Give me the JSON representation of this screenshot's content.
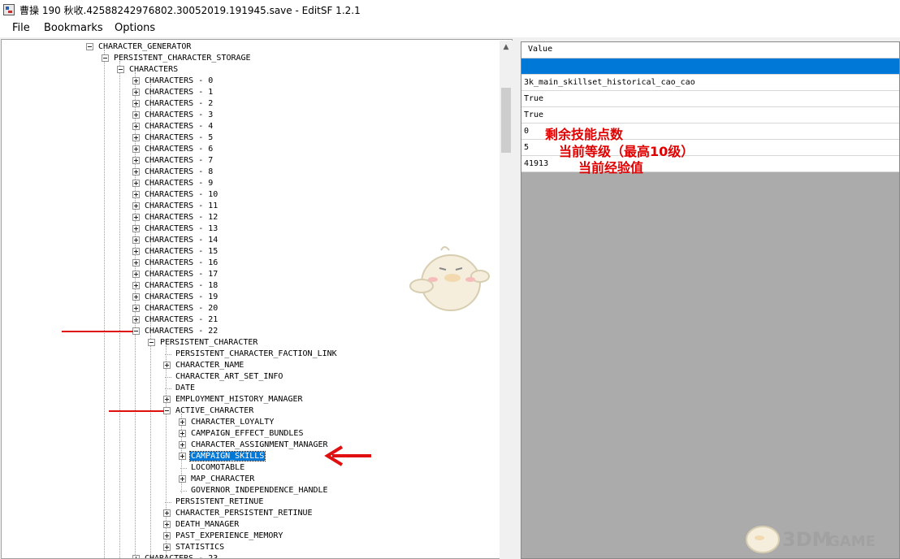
{
  "window": {
    "title": "曹操 190 秋收.42588242976802.30052019.191945.save - EditSF 1.2.1"
  },
  "menu": {
    "items": [
      "File",
      "Bookmarks",
      "Options"
    ]
  },
  "tree": {
    "rows": [
      {
        "label": "CHARACTER_GENERATOR",
        "level": 0,
        "expander": "minus"
      },
      {
        "label": "PERSISTENT_CHARACTER_STORAGE",
        "level": 1,
        "expander": "minus"
      },
      {
        "label": "CHARACTERS",
        "level": 2,
        "expander": "minus"
      },
      {
        "label": "CHARACTERS - 0",
        "level": 3,
        "expander": "plus"
      },
      {
        "label": "CHARACTERS - 1",
        "level": 3,
        "expander": "plus"
      },
      {
        "label": "CHARACTERS - 2",
        "level": 3,
        "expander": "plus"
      },
      {
        "label": "CHARACTERS - 3",
        "level": 3,
        "expander": "plus"
      },
      {
        "label": "CHARACTERS - 4",
        "level": 3,
        "expander": "plus"
      },
      {
        "label": "CHARACTERS - 5",
        "level": 3,
        "expander": "plus"
      },
      {
        "label": "CHARACTERS - 6",
        "level": 3,
        "expander": "plus"
      },
      {
        "label": "CHARACTERS - 7",
        "level": 3,
        "expander": "plus"
      },
      {
        "label": "CHARACTERS - 8",
        "level": 3,
        "expander": "plus"
      },
      {
        "label": "CHARACTERS - 9",
        "level": 3,
        "expander": "plus"
      },
      {
        "label": "CHARACTERS - 10",
        "level": 3,
        "expander": "plus"
      },
      {
        "label": "CHARACTERS - 11",
        "level": 3,
        "expander": "plus"
      },
      {
        "label": "CHARACTERS - 12",
        "level": 3,
        "expander": "plus"
      },
      {
        "label": "CHARACTERS - 13",
        "level": 3,
        "expander": "plus"
      },
      {
        "label": "CHARACTERS - 14",
        "level": 3,
        "expander": "plus"
      },
      {
        "label": "CHARACTERS - 15",
        "level": 3,
        "expander": "plus"
      },
      {
        "label": "CHARACTERS - 16",
        "level": 3,
        "expander": "plus"
      },
      {
        "label": "CHARACTERS - 17",
        "level": 3,
        "expander": "plus"
      },
      {
        "label": "CHARACTERS - 18",
        "level": 3,
        "expander": "plus"
      },
      {
        "label": "CHARACTERS - 19",
        "level": 3,
        "expander": "plus"
      },
      {
        "label": "CHARACTERS - 20",
        "level": 3,
        "expander": "plus"
      },
      {
        "label": "CHARACTERS - 21",
        "level": 3,
        "expander": "plus"
      },
      {
        "label": "CHARACTERS - 22",
        "level": 3,
        "expander": "minus"
      },
      {
        "label": "PERSISTENT_CHARACTER",
        "level": 4,
        "expander": "minus"
      },
      {
        "label": "PERSISTENT_CHARACTER_FACTION_LINK",
        "level": 5,
        "expander": "none"
      },
      {
        "label": "CHARACTER_NAME",
        "level": 5,
        "expander": "plus"
      },
      {
        "label": "CHARACTER_ART_SET_INFO",
        "level": 5,
        "expander": "none"
      },
      {
        "label": "DATE",
        "level": 5,
        "expander": "none"
      },
      {
        "label": "EMPLOYMENT_HISTORY_MANAGER",
        "level": 5,
        "expander": "plus"
      },
      {
        "label": "ACTIVE_CHARACTER",
        "level": 5,
        "expander": "minus"
      },
      {
        "label": "CHARACTER_LOYALTY",
        "level": 6,
        "expander": "plus"
      },
      {
        "label": "CAMPAIGN_EFFECT_BUNDLES",
        "level": 6,
        "expander": "plus"
      },
      {
        "label": "CHARACTER_ASSIGNMENT_MANAGER",
        "level": 6,
        "expander": "plus"
      },
      {
        "label": "CAMPAIGN_SKILLS",
        "level": 6,
        "expander": "plus",
        "selected": true
      },
      {
        "label": "LOCOMOTABLE",
        "level": 6,
        "expander": "none"
      },
      {
        "label": "MAP_CHARACTER",
        "level": 6,
        "expander": "plus"
      },
      {
        "label": "GOVERNOR_INDEPENDENCE_HANDLE",
        "level": 6,
        "expander": "none"
      },
      {
        "label": "PERSISTENT_RETINUE",
        "level": 5,
        "expander": "none"
      },
      {
        "label": "CHARACTER_PERSISTENT_RETINUE",
        "level": 5,
        "expander": "plus"
      },
      {
        "label": "DEATH_MANAGER",
        "level": 5,
        "expander": "plus"
      },
      {
        "label": "PAST_EXPERIENCE_MEMORY",
        "level": 5,
        "expander": "plus"
      },
      {
        "label": "STATISTICS",
        "level": 5,
        "expander": "plus"
      },
      {
        "label": "CHARACTERS - 23",
        "level": 3,
        "expander": "plus"
      }
    ]
  },
  "grid": {
    "header": "Value",
    "rows": [
      {
        "value": "",
        "selected": true
      },
      {
        "value": "3k_main_skillset_historical_cao_cao"
      },
      {
        "value": "True"
      },
      {
        "value": "True"
      },
      {
        "value": "0"
      },
      {
        "value": "5"
      },
      {
        "value": "41913"
      }
    ]
  },
  "annotations": {
    "skill_points": "剩余技能点数",
    "level": "当前等级（最高10级）",
    "experience": "当前经验值"
  },
  "watermark": {
    "text_3dm": "3DM",
    "text_game": "GAME"
  },
  "colors": {
    "selection": "#0078d7",
    "annotation_red": "#e00000"
  }
}
